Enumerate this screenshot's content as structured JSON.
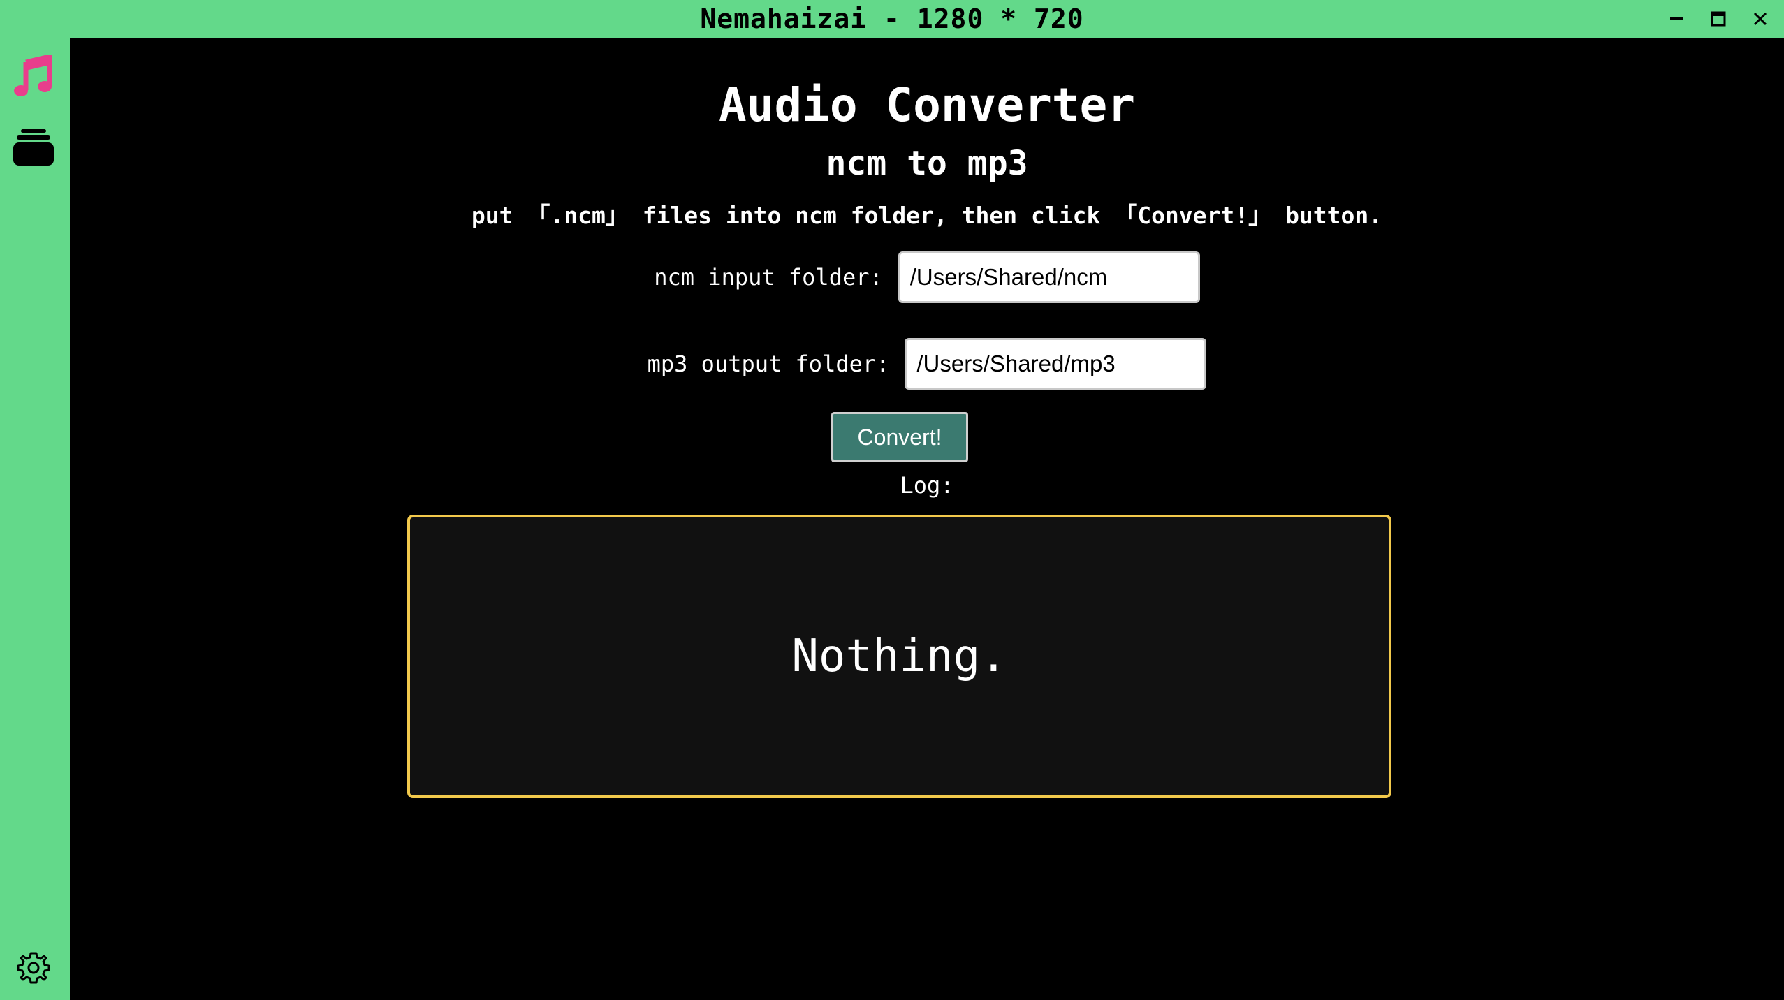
{
  "window": {
    "title": "Nemahaizai - 1280 * 720",
    "controls": [
      "minimize-icon",
      "maximize-icon",
      "close-icon"
    ]
  },
  "sidebar": {
    "items": [
      {
        "icon": "music-note-icon",
        "color": "#e83e8c"
      },
      {
        "icon": "stack-icon",
        "color": "#000000"
      }
    ],
    "bottom": {
      "icon": "gear-icon"
    }
  },
  "main": {
    "title": "Audio Converter",
    "subtitle": "ncm to mp3",
    "instruction": "put 「.ncm」 files into ncm folder, then click 「Convert!」 button.",
    "input_folder": {
      "label": "ncm input folder:",
      "value": "/Users/Shared/ncm"
    },
    "output_folder": {
      "label": "mp3 output folder:",
      "value": "/Users/Shared/mp3"
    },
    "convert_label": "Convert!",
    "log_label": "Log:",
    "log_text": "Nothing."
  },
  "colors": {
    "accent": "#63d98a",
    "button": "#3b7a70",
    "log_border": "#f2c94c"
  }
}
